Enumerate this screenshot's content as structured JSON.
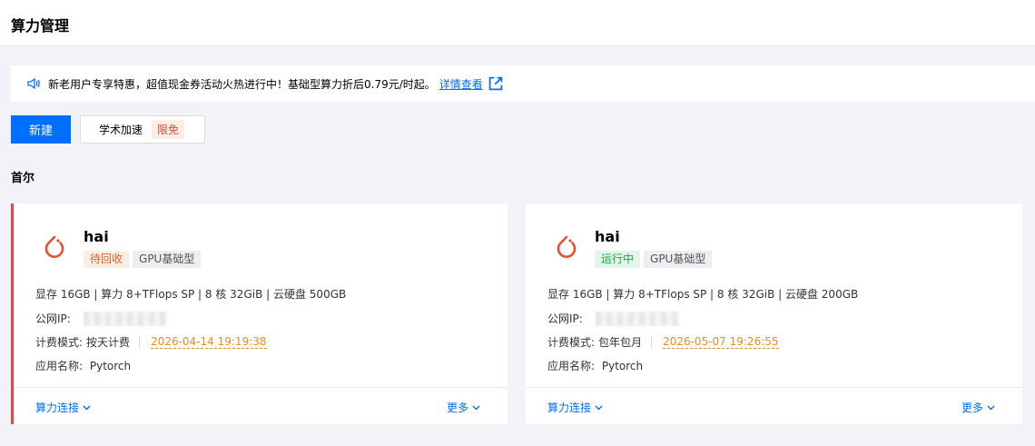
{
  "header": {
    "title": "算力管理"
  },
  "notice": {
    "text": "新老用户专享特惠，超值现金券活动火热进行中！基础型算力折后0.79元/时起。",
    "link_label": "详情查看"
  },
  "toolbar": {
    "new_label": "新建",
    "accel_label": "学术加速",
    "accel_badge": "限免"
  },
  "region": {
    "title": "首尔"
  },
  "instances": [
    {
      "name": "hai",
      "status": "待回收",
      "type": "GPU基础型",
      "spec": "显存 16GB | 算力 8+TFlops SP | 8 核 32GiB | 云硬盘 500GB",
      "ip_label": "公网IP:",
      "billing_label": "计费模式:",
      "billing_value": "按天计费",
      "expire": "2026-04-14 19:19:38",
      "app_label": "应用名称:",
      "app_value": "Pytorch",
      "connect_label": "算力连接",
      "more_label": "更多"
    },
    {
      "name": "hai",
      "status": "运行中",
      "type": "GPU基础型",
      "spec": "显存 16GB | 算力 8+TFlops SP | 8 核 32GiB | 云硬盘 200GB",
      "ip_label": "公网IP:",
      "billing_label": "计费模式:",
      "billing_value": "包年包月",
      "expire": "2026-05-07 19:26:55",
      "app_label": "应用名称:",
      "app_value": "Pytorch",
      "connect_label": "算力连接",
      "more_label": "更多"
    }
  ],
  "colors": {
    "accent": "#006eff",
    "danger": "#e54545",
    "warning": "#f38b1c",
    "success": "#0aaf44"
  }
}
